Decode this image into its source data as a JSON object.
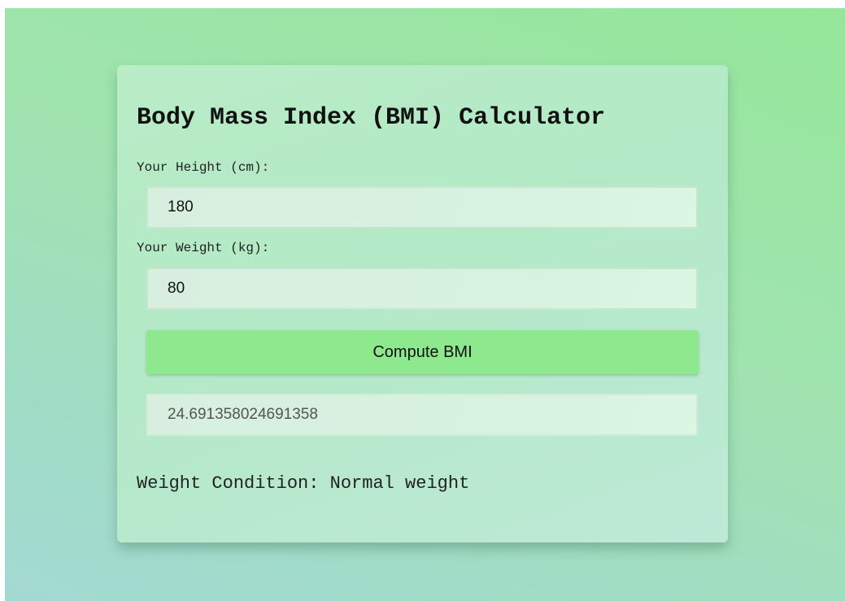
{
  "calculator": {
    "title": "Body Mass Index (BMI) Calculator",
    "height_label": "Your Height (cm):",
    "height_value": "180",
    "weight_label": "Your Weight (kg):",
    "weight_value": "80",
    "compute_label": "Compute BMI",
    "bmi_result": "24.691358024691358",
    "condition_text": "Weight Condition: Normal weight"
  },
  "colors": {
    "button": "#8ee88e",
    "background_start": "#95e69a",
    "background_end": "#a4d9d3"
  }
}
